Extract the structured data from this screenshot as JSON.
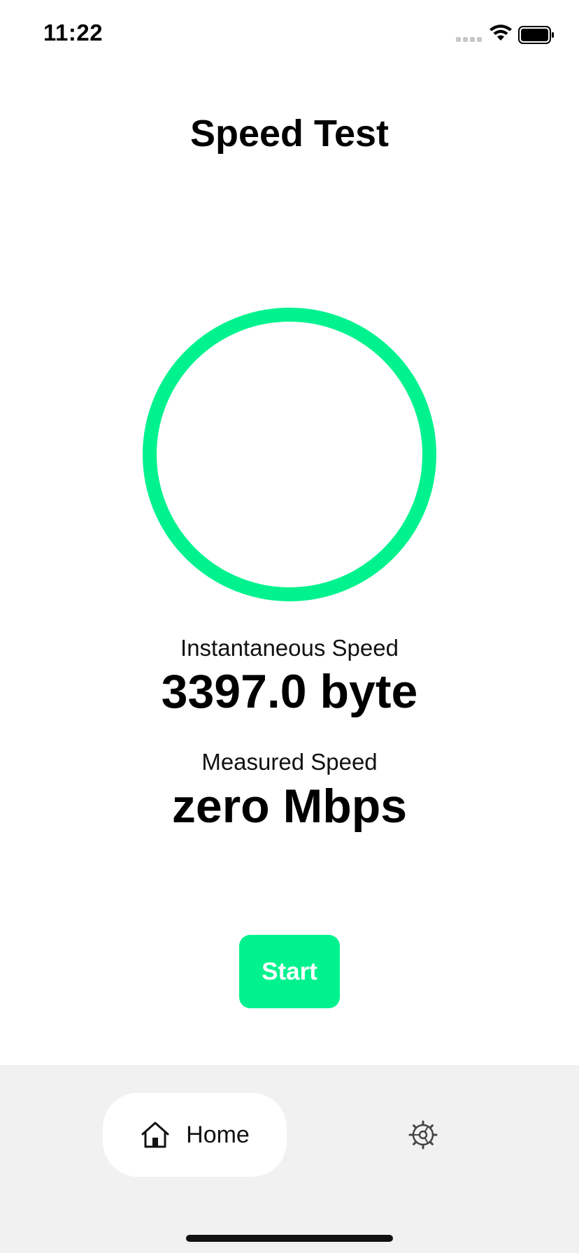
{
  "status_bar": {
    "time": "11:22"
  },
  "page": {
    "title": "Speed Test"
  },
  "gauge": {
    "color": "#00f28f"
  },
  "instantaneous": {
    "label": "Instantaneous Speed",
    "value": "3397.0 byte"
  },
  "measured": {
    "label": "Measured Speed",
    "value": "zero Mbps"
  },
  "actions": {
    "start_label": "Start"
  },
  "tab_bar": {
    "home_label": "Home",
    "home_icon": "house-icon",
    "settings_icon": "gear-icon"
  }
}
